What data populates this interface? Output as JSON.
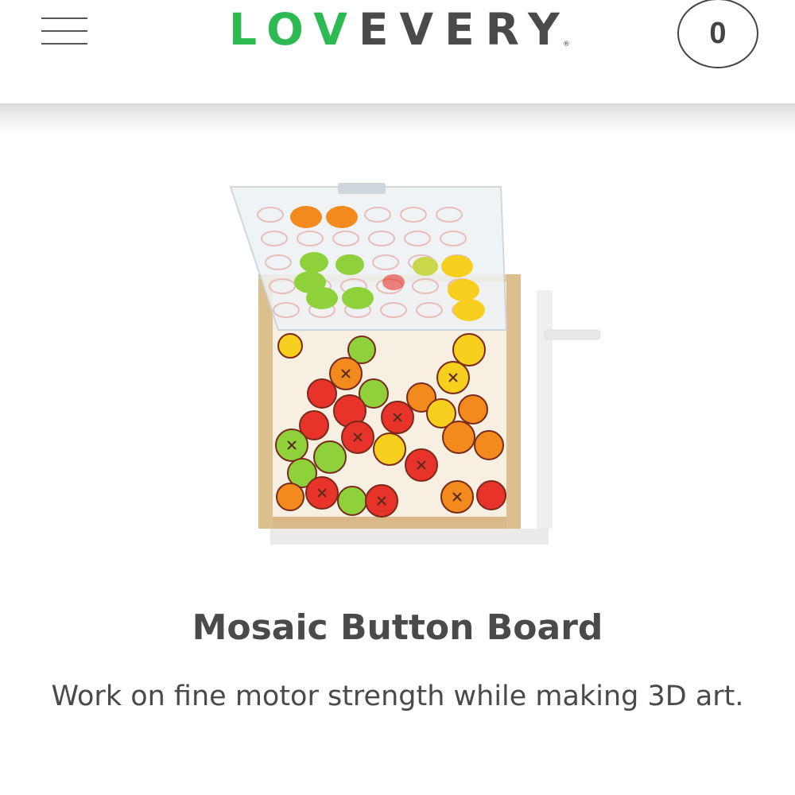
{
  "header": {
    "menu_icon": "hamburger-menu-icon",
    "logo": {
      "part1": "LOV",
      "part2": "EVERY",
      "registered_mark": "®",
      "colors": {
        "love": "#2dba52",
        "every": "#4a4a4a"
      }
    },
    "cart": {
      "count": "0",
      "icon": "cart-count-circle"
    }
  },
  "product": {
    "image_alt_icon": "mosaic-button-board-photo",
    "title": "Mosaic Button Board",
    "description": "Work on fine motor strength while making 3D art."
  },
  "button_colors": {
    "red": "#e8332b",
    "orange": "#f28a1e",
    "yellow": "#f6cf1f",
    "green": "#8fd13a"
  }
}
